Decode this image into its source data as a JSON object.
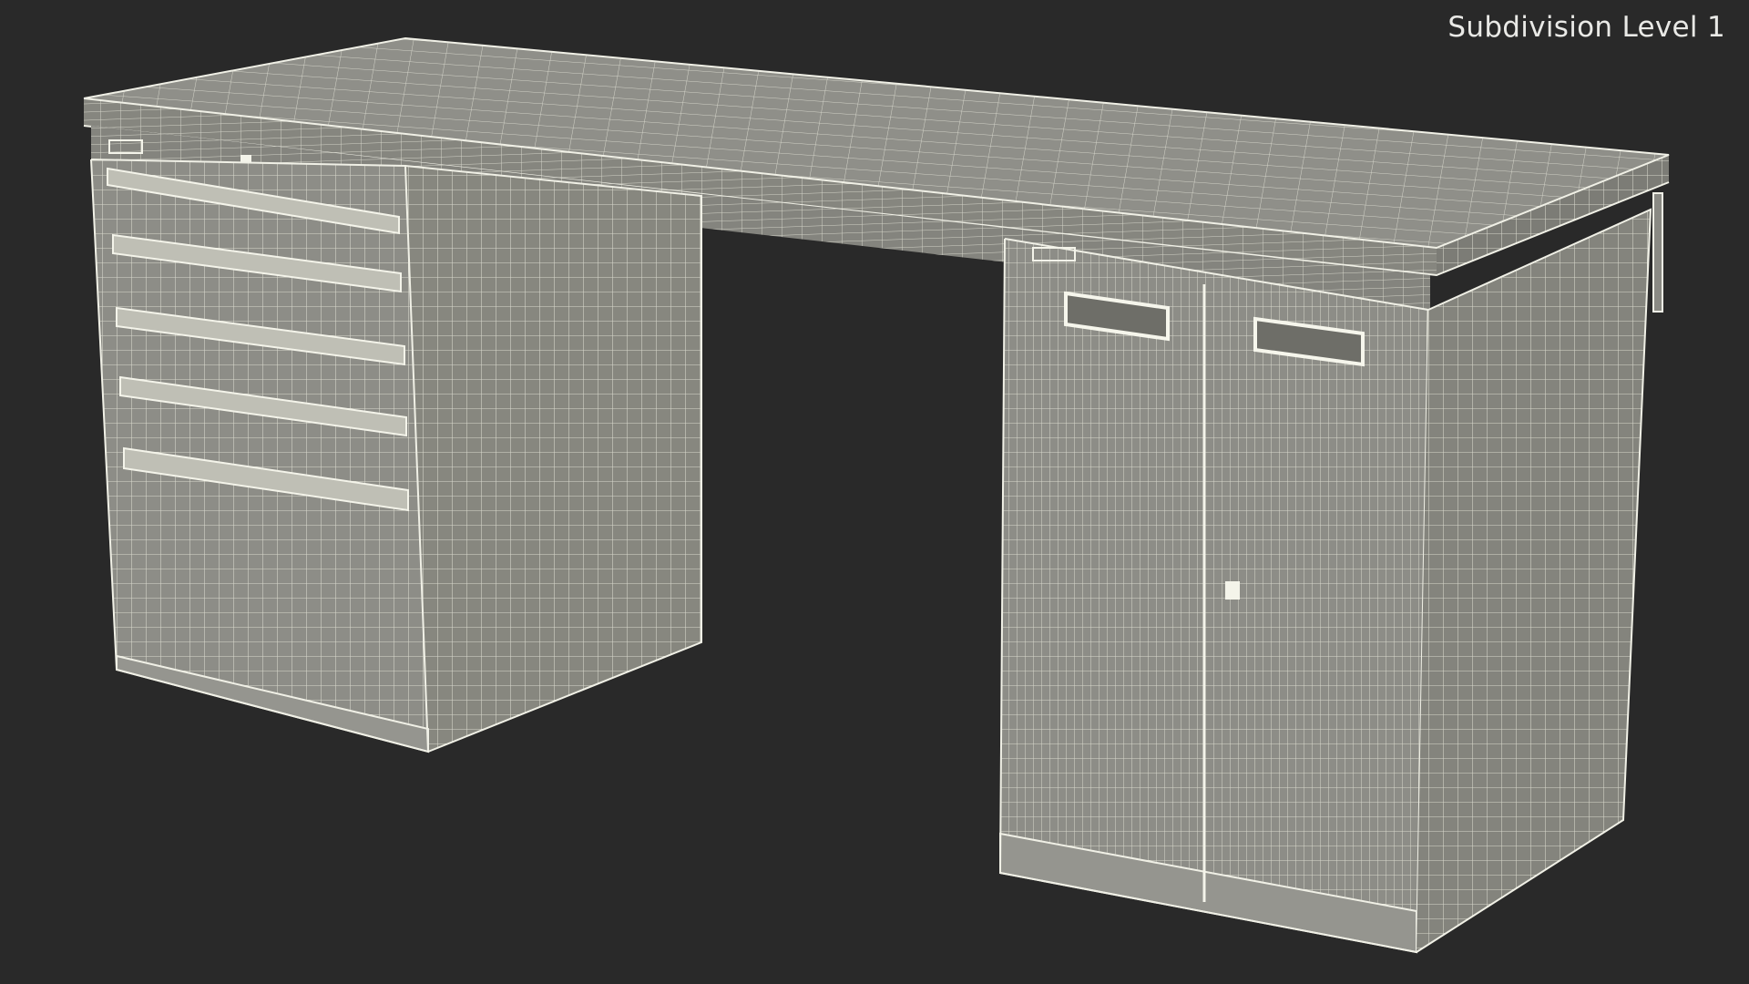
{
  "viewport": {
    "label": "Subdivision Level 1",
    "background_color": "#292929",
    "surface_color": "#8c8c86",
    "wire_color": "#e6e6da"
  },
  "model": {
    "subject": "desk with drawer pedestal and two-door cabinet",
    "display_mode": "wireframe on shaded"
  }
}
